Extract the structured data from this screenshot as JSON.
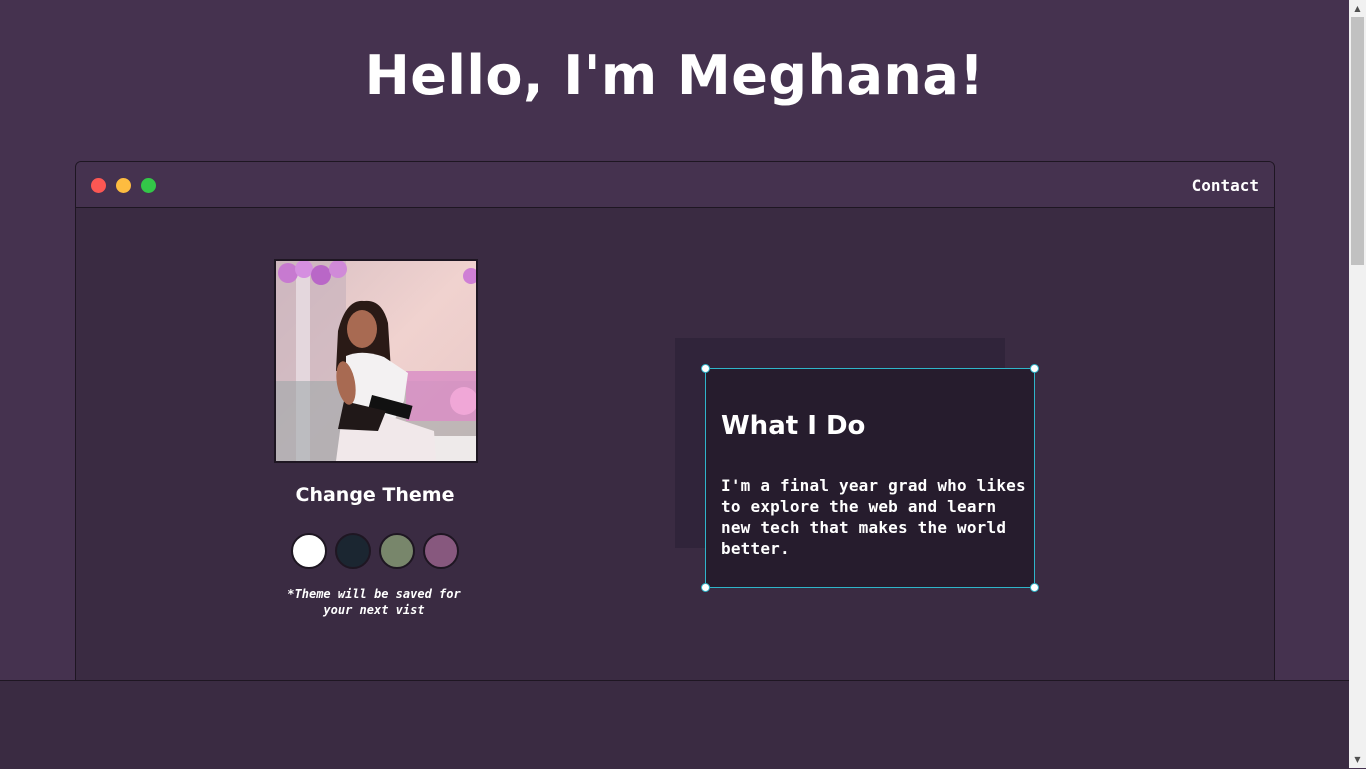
{
  "hero": {
    "title": "Hello, I'm Meghana!"
  },
  "window": {
    "controls": [
      "close",
      "minimize",
      "maximize"
    ],
    "nav": {
      "contact_label": "Contact"
    }
  },
  "profile": {
    "photo_alt": "Profile photo",
    "theme_heading": "Change Theme",
    "themes": [
      {
        "name": "white",
        "color": "#ffffff"
      },
      {
        "name": "dark-navy",
        "color": "#1b2631"
      },
      {
        "name": "sage-green",
        "color": "#78866b"
      },
      {
        "name": "purple",
        "color": "#87587e"
      }
    ],
    "theme_note": "*Theme will be saved for your next vist"
  },
  "about": {
    "title": "What I Do",
    "body": "I'm a final year grad who likes to explore the web and learn new tech that makes the world better."
  },
  "colors": {
    "background": "#45324f",
    "window_body": "#3a2b42",
    "card": "#261c2d",
    "selection": "#2fb5c9"
  }
}
